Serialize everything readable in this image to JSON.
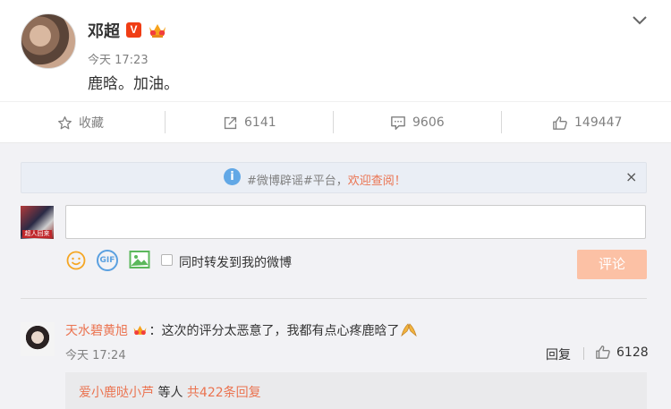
{
  "post": {
    "username": "邓超",
    "verified_badge": "V",
    "timestamp": "今天 17:23",
    "text": "鹿晗。加油。",
    "icons": [
      "crown-badge-icon",
      "chevron-down-icon"
    ]
  },
  "actions": {
    "favorite": {
      "label": "收藏",
      "icon": "star-icon"
    },
    "repost": {
      "count": "6141",
      "icon": "share-icon"
    },
    "comment": {
      "count": "9606",
      "icon": "comment-icon"
    },
    "like": {
      "count": "149447",
      "icon": "thumbs-up-icon"
    }
  },
  "notice": {
    "icon_glyph": "i",
    "text": "#微博辟谣#平台，",
    "link": "欢迎查阅！",
    "close": "×"
  },
  "composer": {
    "avatar_tag": "超人回来",
    "input_value": "",
    "gif_label": "GIF",
    "repost_label": "同时转发到我的微博",
    "submit_label": "评论"
  },
  "comment": {
    "user": "天水碧黄旭",
    "text": "：这次的评分太恶意了，我都有点心疼鹿晗了",
    "time": "今天 17:24",
    "reply_label": "回复",
    "like_count": "6128"
  },
  "replies": {
    "user": "爱小鹿哒小芦",
    "middle": " 等人 ",
    "count": "共422条回复"
  },
  "colors": {
    "accent": "#eb7350",
    "verified": "#f03d14",
    "info": "#62a8e6",
    "submit_disabled": "#fcc1a5"
  }
}
